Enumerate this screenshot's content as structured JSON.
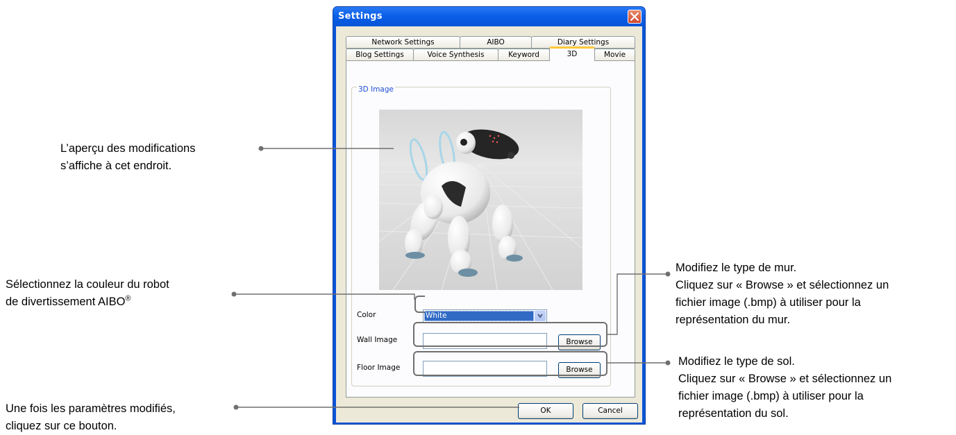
{
  "annotations": {
    "preview_note": [
      "L’aperçu des modifications",
      "s’affiche à cet endroit."
    ],
    "color_note_line1": "Sélectionnez la couleur du robot",
    "color_note_line2": "de divertissement AIBO",
    "color_note_mark": "®",
    "ok_note": [
      "Une fois les paramètres modifiés,",
      "cliquez sur ce bouton."
    ],
    "wall_note": [
      "Modifiez le type de mur.",
      "Cliquez sur « Browse » et sélectionnez un",
      "fichier image (.bmp) à utiliser pour la",
      "représentation du mur."
    ],
    "floor_note": [
      "Modifiez le type de sol.",
      "Cliquez sur « Browse » et sélectionnez un",
      "fichier image (.bmp) à utiliser pour la",
      "représentation du sol."
    ]
  },
  "dialog": {
    "title": "Settings",
    "tabs_row1": [
      "Network Settings",
      "AIBO",
      "Diary Settings"
    ],
    "tabs_row2": [
      "Blog Settings",
      "Voice Synthesis",
      "Keyword",
      "3D",
      "Movie"
    ],
    "active_tab": "3D",
    "group_label": "3D Image",
    "color_label": "Color",
    "color_value": "White",
    "wall_label": "Wall Image",
    "wall_value": "",
    "floor_label": "Floor Image",
    "floor_value": "",
    "browse_label": "Browse",
    "ok_label": "OK",
    "cancel_label": "Cancel"
  },
  "colors": {
    "titlebar": "#0a5fe8",
    "selection": "#316ac5",
    "active_tab_accent": "#ffc83c",
    "callout_line": "#6f6f6f"
  }
}
